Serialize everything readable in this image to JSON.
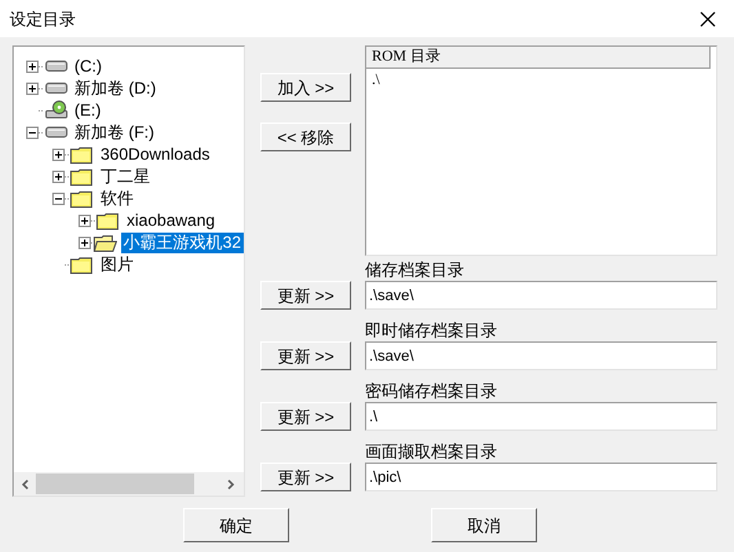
{
  "window": {
    "title": "设定目录"
  },
  "tree": [
    {
      "label": "(C:)",
      "kind": "drive",
      "expanded": false,
      "selected": false
    },
    {
      "label": "新加卷 (D:)",
      "kind": "drive",
      "expanded": false,
      "selected": false
    },
    {
      "label": "(E:)",
      "kind": "cdrom",
      "selected": false
    },
    {
      "label": "新加卷 (F:)",
      "kind": "drive",
      "expanded": true,
      "selected": false,
      "children": [
        {
          "label": "360Downloads",
          "kind": "folder",
          "expanded": false,
          "selected": false
        },
        {
          "label": "丁二星",
          "kind": "folder",
          "expanded": false,
          "selected": false
        },
        {
          "label": "软件",
          "kind": "folder",
          "expanded": true,
          "selected": false,
          "children": [
            {
              "label": "xiaobawang",
              "kind": "folder",
              "expanded": false,
              "selected": false
            },
            {
              "label": "小霸王游戏机32",
              "kind": "folder",
              "expanded": false,
              "selected": true
            }
          ]
        },
        {
          "label": "图片",
          "kind": "folder",
          "selected": false
        }
      ]
    }
  ],
  "add_button": "加入 >>",
  "remove_button": "<< 移除",
  "rom_list": {
    "header": "ROM 目录",
    "items": [
      ".\\"
    ]
  },
  "dirs": [
    {
      "label": "储存档案目录",
      "button": "更新 >>",
      "value": ".\\save\\"
    },
    {
      "label": "即时储存档案目录",
      "button": "更新 >>",
      "value": ".\\save\\"
    },
    {
      "label": "密码储存档案目录",
      "button": "更新 >>",
      "value": ".\\"
    },
    {
      "label": "画面撷取档案目录",
      "button": "更新 >>",
      "value": ".\\pic\\"
    }
  ],
  "ok_button": "确定",
  "cancel_button": "取消"
}
